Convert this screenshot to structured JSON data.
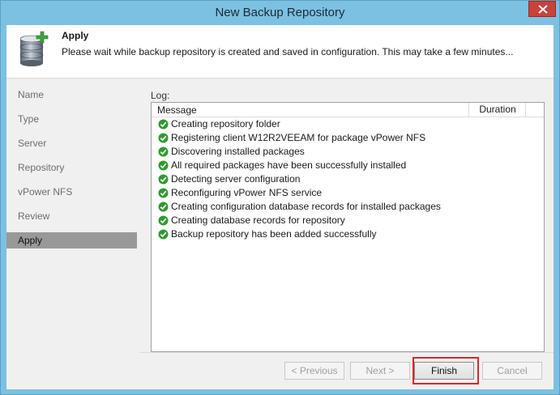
{
  "window": {
    "title": "New Backup Repository"
  },
  "header": {
    "title": "Apply",
    "description": "Please wait while backup repository is created and saved in configuration. This may take a few minutes..."
  },
  "nav": {
    "items": [
      {
        "label": "Name"
      },
      {
        "label": "Type"
      },
      {
        "label": "Server"
      },
      {
        "label": "Repository"
      },
      {
        "label": "vPower NFS"
      },
      {
        "label": "Review"
      },
      {
        "label": "Apply",
        "active": true
      }
    ]
  },
  "log": {
    "label": "Log:",
    "columns": {
      "message": "Message",
      "duration": "Duration"
    },
    "rows": [
      {
        "message": "Creating repository folder",
        "status": "success"
      },
      {
        "message": "Registering client W12R2VEEAM for package vPower NFS",
        "status": "success"
      },
      {
        "message": "Discovering installed packages",
        "status": "success"
      },
      {
        "message": "All required packages have been successfully installed",
        "status": "success"
      },
      {
        "message": "Detecting server configuration",
        "status": "success"
      },
      {
        "message": "Reconfiguring vPower NFS service",
        "status": "success"
      },
      {
        "message": "Creating configuration database records for installed packages",
        "status": "success"
      },
      {
        "message": "Creating database records for repository",
        "status": "success"
      },
      {
        "message": "Backup repository has been added successfully",
        "status": "success"
      }
    ]
  },
  "buttons": {
    "previous": "< Previous",
    "next": "Next >",
    "finish": "Finish",
    "cancel": "Cancel"
  },
  "colors": {
    "success": "#2f9a2f",
    "highlight": "#d9262a",
    "titlebar": "#7cc0e2"
  }
}
